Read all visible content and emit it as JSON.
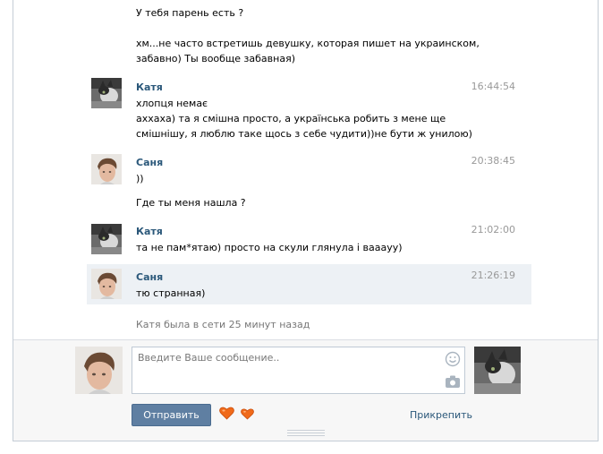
{
  "messages": [
    {
      "id": "m0",
      "lines": [
        "У тебя парень есть ?"
      ]
    },
    {
      "id": "m0b",
      "lines": [
        "хм...не часто встретишь девушку, которая пишет на украинском,",
        "забавно) Ты вообще забавная)"
      ]
    },
    {
      "id": "m1",
      "author": "Катя",
      "time": "16:44:54",
      "avatar": "cat-avatar",
      "lines": [
        "хлопця немає",
        "аххаха) та я смішна просто, а українська робить з мене ще",
        "смішнішу, я люблю таке щось з себе чудити))не бути ж унилою)"
      ]
    },
    {
      "id": "m2",
      "author": "Саня",
      "time": "20:38:45",
      "avatar": "boy-avatar",
      "lines": [
        "))"
      ]
    },
    {
      "id": "m2b",
      "lines": [
        "Где ты меня нашла ?"
      ]
    },
    {
      "id": "m3",
      "author": "Катя",
      "time": "21:02:00",
      "avatar": "cat-avatar",
      "lines": [
        "та не пам*ятаю) просто на скули глянула і вааауу)"
      ]
    },
    {
      "id": "m4",
      "author": "Саня",
      "time": "21:26:19",
      "avatar": "boy-avatar",
      "highlighted": true,
      "lines": [
        "тю странная)"
      ]
    }
  ],
  "status_text": "Катя была в сети 25 минут назад",
  "composer": {
    "placeholder": "Введите Ваше сообщение..",
    "send_label": "Отправить",
    "attach_label": "Прикрепить",
    "icons": [
      "smile-icon",
      "camera-icon",
      "heart-icon",
      "heart-icon"
    ]
  },
  "colors": {
    "author": "#2b587a",
    "time": "#999999",
    "button": "#5f7fa2",
    "highlight": "#edf1f5",
    "heart": "#f06a1a"
  }
}
